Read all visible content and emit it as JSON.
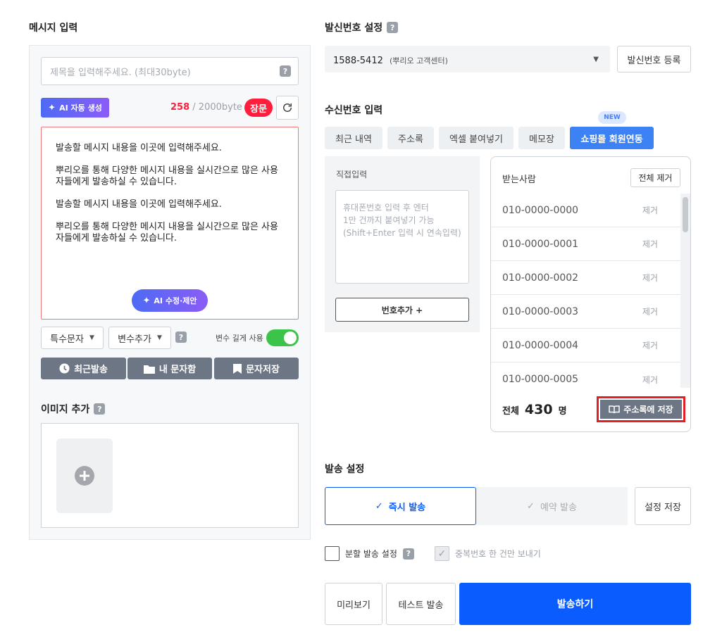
{
  "message": {
    "section_title": "메시지 입력",
    "title_placeholder": "제목을 입력해주세요. (최대30byte)",
    "ai_generate_label": "AI 자동 생성",
    "byte_count": "258",
    "byte_limit": "/ 2000byte",
    "type_badge": "장문",
    "body_paragraphs": [
      "발송할 메시지 내용을 이곳에 입력해주세요.",
      "뿌리오를 통해 다양한 메시지 내용을 실시간으로 많은 사용자들에게 발송하실 수 있습니다.",
      "발송할 메시지 내용을 이곳에 입력해주세요.",
      "뿌리오를 통해 다양한 메시지 내용을 실시간으로 많은 사용자들에게 발송하실 수 있습니다."
    ],
    "ai_suggest_label": "AI 수정·제안",
    "special_char_label": "특수문자",
    "variable_add_label": "변수추가",
    "variable_long_label": "변수 길게 사용",
    "recent_send_label": "최근발송",
    "my_messages_label": "내 문자함",
    "save_message_label": "문자저장"
  },
  "image": {
    "section_title": "이미지 추가"
  },
  "sender": {
    "section_title": "발신번호 설정",
    "number": "1588-5412",
    "number_note": "(뿌리오 고객센터)",
    "register_label": "발신번호 등록"
  },
  "recipient": {
    "section_title": "수신번호 입력",
    "new_badge": "NEW",
    "tabs": [
      "최근 내역",
      "주소록",
      "엑셀 붙여넣기",
      "메모장",
      "쇼핑몰 회원연동"
    ],
    "direct_title": "직접입력",
    "direct_placeholder": "휴대폰번호 입력 후 엔터\n1만 건까지 붙여넣기 가능\n(Shift+Enter 입력 시 연속입력)",
    "add_number_label": "번호추가 +",
    "list_title": "받는사람",
    "remove_all_label": "전체 제거",
    "numbers": [
      "010-0000-0000",
      "010-0000-0001",
      "010-0000-0002",
      "010-0000-0003",
      "010-0000-0004",
      "010-0000-0005"
    ],
    "remove_label": "제거",
    "total_label": "전체",
    "total_count": "430",
    "total_unit": "명",
    "save_to_contacts_label": "주소록에 저장"
  },
  "send": {
    "section_title": "발송 설정",
    "instant_label": "즉시 발송",
    "scheduled_label": "예약 발송",
    "save_settings_label": "설정 저장",
    "split_label": "분할 발송 설정",
    "dedupe_label": "중복번호 한 건만 보내기",
    "preview_label": "미리보기",
    "test_label": "테스트 발송",
    "send_label": "발송하기"
  },
  "colors": {
    "accent": "#0a5cff",
    "tab_active": "#3d82f5",
    "badge_red": "#ff1f3d",
    "toggle": "#3cc34a",
    "highlight": "#e01f26"
  }
}
